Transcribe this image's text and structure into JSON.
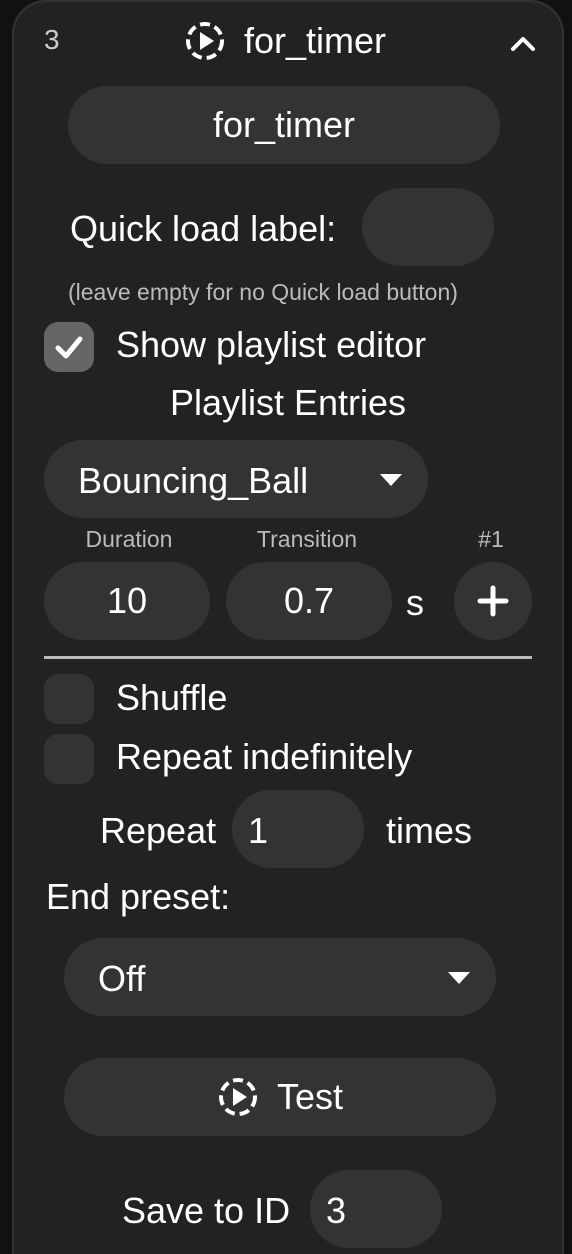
{
  "header": {
    "id_number": "3",
    "title": "for_timer",
    "collapse_icon": "chevron-up-icon",
    "playlist_icon": "playlist-play-icon"
  },
  "name_field": {
    "value": "for_timer"
  },
  "quick_load": {
    "label": "Quick load label:",
    "value": "",
    "hint": "(leave empty for no Quick load button)"
  },
  "show_editor": {
    "label": "Show playlist editor",
    "checked": true
  },
  "playlist": {
    "heading": "Playlist Entries",
    "entries": [
      {
        "preset": "Bouncing_Ball",
        "duration_label": "Duration",
        "transition_label": "Transition",
        "index_label": "#1",
        "duration": "10",
        "transition": "0.7",
        "unit": "s",
        "add_label": "+"
      }
    ]
  },
  "shuffle": {
    "label": "Shuffle",
    "checked": false
  },
  "repeat_indef": {
    "label": "Repeat indefinitely",
    "checked": false
  },
  "repeat": {
    "label": "Repeat",
    "value": "1",
    "suffix": "times"
  },
  "end_preset": {
    "label": "End preset:",
    "value": "Off"
  },
  "test_button": {
    "label": "Test"
  },
  "save": {
    "label": "Save to ID",
    "value": "3"
  },
  "colors": {
    "card_bg": "#222222",
    "field_bg": "#333333",
    "checked_bg": "#666666",
    "text": "#ffffff",
    "muted_text": "#bbbbbb"
  }
}
